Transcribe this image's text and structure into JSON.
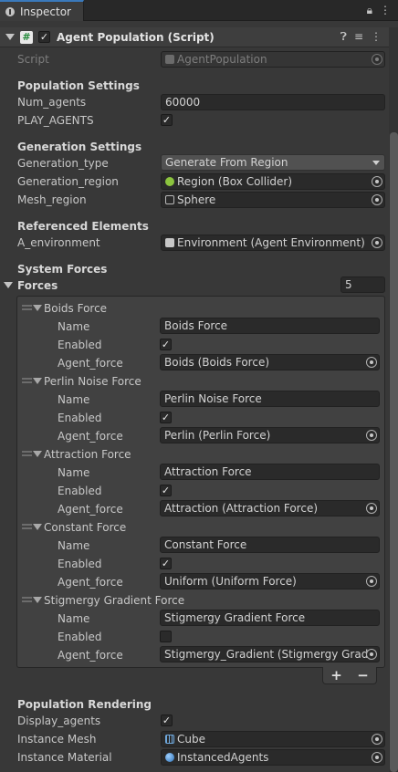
{
  "tab": {
    "title": "Inspector"
  },
  "toolbar_icons": {
    "lock": "lock-icon",
    "menu": "kebab-icon"
  },
  "component": {
    "title": "Agent Population (Script)",
    "enabled": true,
    "icons": [
      "help-icon",
      "presets-icon",
      "kebab-icon"
    ]
  },
  "script": {
    "label": "Script",
    "value": "AgentPopulation"
  },
  "population_settings": {
    "header": "Population Settings",
    "num_agents_label": "Num_agents",
    "num_agents": "60000",
    "play_agents_label": "PLAY_AGENTS",
    "play_agents": true
  },
  "generation_settings": {
    "header": "Generation Settings",
    "type_label": "Generation_type",
    "type_value": "Generate From Region",
    "region_label": "Generation_region",
    "region_value": "Region (Box Collider)",
    "mesh_label": "Mesh_region",
    "mesh_value": "Sphere"
  },
  "referenced": {
    "header": "Referenced Elements",
    "env_label": "A_environment",
    "env_value": "Environment (Agent Environment)"
  },
  "system_forces": {
    "header": "System Forces",
    "forces_label": "Forces",
    "count": "5",
    "items": [
      {
        "title": "Boids Force",
        "name_label": "Name",
        "name": "Boids Force",
        "enabled_label": "Enabled",
        "enabled": true,
        "force_label": "Agent_force",
        "force": "Boids (Boids Force)"
      },
      {
        "title": "Perlin Noise Force",
        "name_label": "Name",
        "name": "Perlin Noise Force",
        "enabled_label": "Enabled",
        "enabled": true,
        "force_label": "Agent_force",
        "force": "Perlin (Perlin Force)"
      },
      {
        "title": "Attraction Force",
        "name_label": "Name",
        "name": "Attraction Force",
        "enabled_label": "Enabled",
        "enabled": true,
        "force_label": "Agent_force",
        "force": "Attraction (Attraction Force)"
      },
      {
        "title": "Constant Force",
        "name_label": "Name",
        "name": "Constant Force",
        "enabled_label": "Enabled",
        "enabled": true,
        "force_label": "Agent_force",
        "force": "Uniform (Uniform Force)"
      },
      {
        "title": "Stigmergy Gradient Force",
        "name_label": "Name",
        "name": "Stigmergy Gradient Force",
        "enabled_label": "Enabled",
        "enabled": false,
        "force_label": "Agent_force",
        "force": "Stigmergy_Gradient (Stigmergy Grad"
      }
    ],
    "add": "+",
    "remove": "−"
  },
  "rendering": {
    "header": "Population Rendering",
    "display_label": "Display_agents",
    "display": true,
    "mesh_label": "Instance Mesh",
    "mesh_value": "Cube",
    "material_label": "Instance Material",
    "material_value": "InstancedAgents"
  },
  "colors": {
    "accent": "#3a79bb",
    "panel": "#383838",
    "field": "#2a2a2a"
  }
}
